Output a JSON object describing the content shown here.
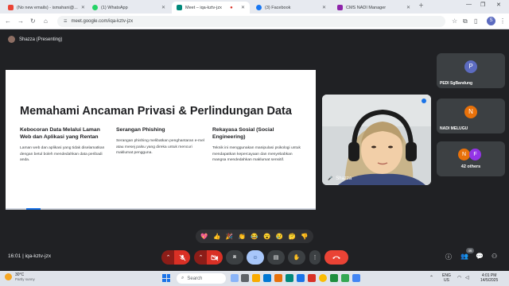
{
  "browser": {
    "tabs": [
      {
        "label": "(No new emails) - ismahani@...",
        "color": "#ea4335",
        "active": false
      },
      {
        "label": "(1) WhatsApp",
        "color": "#25d366",
        "active": false
      },
      {
        "label": "Meet – iqa-kztv-jzx",
        "color": "#00897b",
        "active": true
      },
      {
        "label": "(3) Facebook",
        "color": "#1877f2",
        "active": false
      },
      {
        "label": "CMS NADI Manager",
        "color": "#8e24aa",
        "active": false
      }
    ],
    "url": "meet.google.com/iqa-kztv-jzx",
    "profile_initial": "S"
  },
  "meeting": {
    "presenter_label": "Shazza (Presenting)",
    "time": "16:01",
    "code": "iqa-kztv-jzx",
    "participant_count": "46"
  },
  "slide": {
    "title": "Memahami Ancaman Privasi & Perlindungan Data",
    "columns": [
      {
        "heading": "Kebocoran Data Melalui Laman Web dan Aplikasi yang Rentan",
        "body": "Laman web dan aplikasi yang tidak diselamatkan dengan betul boleh mendedahkan data peribadi anda."
      },
      {
        "heading": "Serangan Phishing",
        "body": "Serangan phishing melibatkan penghantaran e-mel atau mesej palsu yang direka untuk mencuri maklumat pengguna."
      },
      {
        "heading": "Rekayasa Sosial (Social Engineering)",
        "body": "Teknik ini menggunakan manipulasi psikologi untuk mendapatkan kepercayaan dan menyebabkan mangsa mendedahkan maklumat sensitif."
      }
    ]
  },
  "camera": {
    "name": "Shazza"
  },
  "participants": [
    {
      "initial": "P",
      "name": "PEDI SgBandung",
      "color": "#5c6bc0"
    },
    {
      "initial": "N",
      "name": "NADI MELUGU",
      "color": "#e8710a"
    }
  ],
  "others": {
    "initials": [
      "N",
      "F"
    ],
    "label": "42 others"
  },
  "reactions": [
    "💖",
    "👍",
    "🎉",
    "👏",
    "😂",
    "😮",
    "😢",
    "🤔",
    "👎"
  ],
  "taskbar": {
    "weather_temp": "30°C",
    "weather_cond": "Partly sunny",
    "search_placeholder": "Search",
    "lang_line1": "ENG",
    "lang_line2": "US",
    "time": "4:01 PM",
    "date": "14/5/2025"
  },
  "colors": {
    "end_call": "#ea4335",
    "muted_btn": "#8c1d18",
    "accent": "#1a73e8"
  }
}
